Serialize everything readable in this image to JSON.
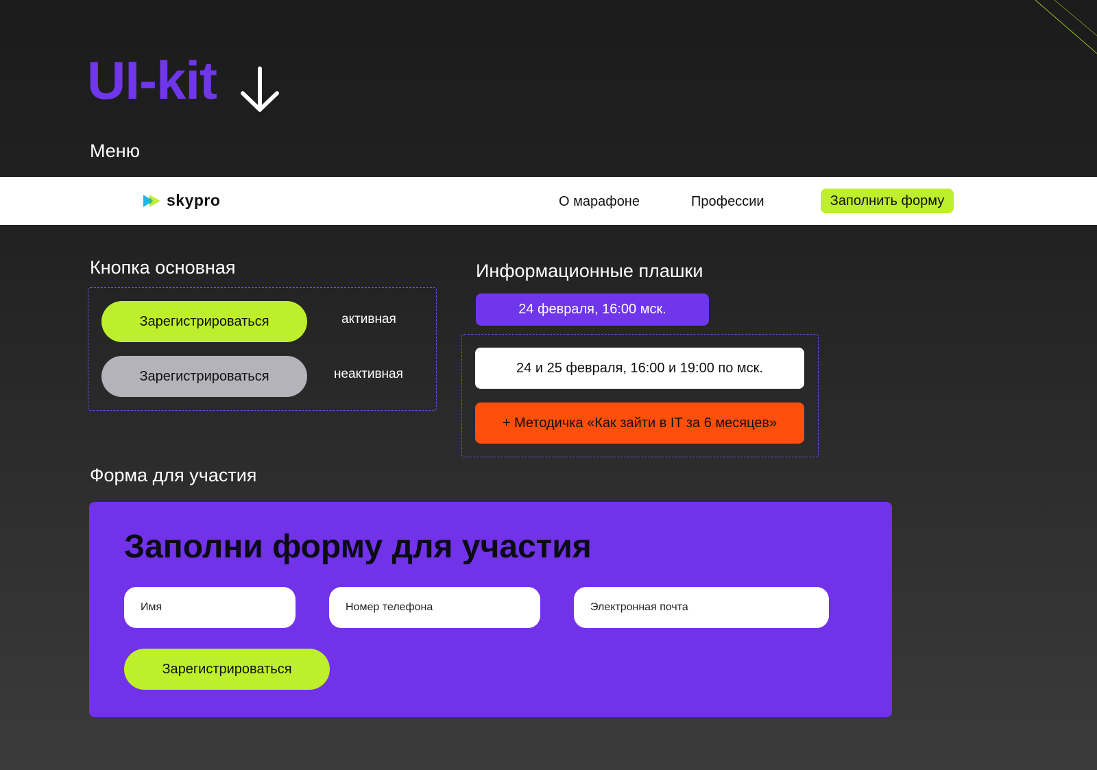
{
  "header": {
    "title": "UI-kit"
  },
  "sections": {
    "menu": "Меню",
    "primary_button": "Кнопка основная",
    "info_badges": "Информационные плашки",
    "form": "Форма для участия"
  },
  "nav": {
    "logo_text": "skypro",
    "links": [
      "О марафоне",
      "Профессии"
    ],
    "cta": "Заполнить форму"
  },
  "buttons": {
    "active_label": "Зарегистрироваться",
    "active_state": "активная",
    "inactive_label": "Зарегистрироваться",
    "inactive_state": "неактивная"
  },
  "badges": {
    "date_short": "24 февраля, 16:00 мск.",
    "date_long": "24 и 25 февраля, 16:00 и 19:00 по мск.",
    "bonus": "+ Методичка «Как зайти в IT за 6 месяцев»"
  },
  "form": {
    "heading": "Заполни форму для участия",
    "fields": {
      "name_placeholder": "Имя",
      "phone_placeholder": "Номер телефона",
      "email_placeholder": "Электронная почта"
    },
    "submit": "Зарегистрироваться"
  },
  "colors": {
    "accent_purple": "#6f36ec",
    "form_purple": "#7132ea",
    "lime": "#bdef2c",
    "orange": "#ff4f0a",
    "inactive_gray": "#b5b3ba"
  },
  "icons": [
    "arrow-down-icon",
    "skypro-logo-icon"
  ]
}
